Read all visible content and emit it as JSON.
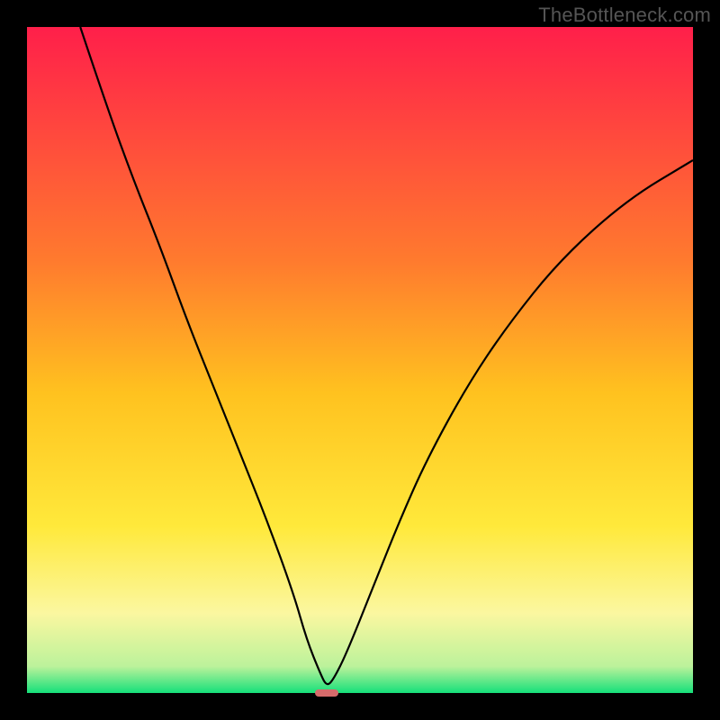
{
  "watermark": "TheBottleneck.com",
  "chart_data": {
    "type": "line",
    "title": "",
    "xlabel": "",
    "ylabel": "",
    "xlim": [
      0,
      100
    ],
    "ylim": [
      0,
      100
    ],
    "grid": false,
    "legend": false,
    "background_gradient": {
      "stops": [
        {
          "pct": 0,
          "color": "#ff1f4a"
        },
        {
          "pct": 35,
          "color": "#ff7a2e"
        },
        {
          "pct": 55,
          "color": "#ffc21f"
        },
        {
          "pct": 75,
          "color": "#ffe93b"
        },
        {
          "pct": 88,
          "color": "#fbf7a0"
        },
        {
          "pct": 96,
          "color": "#bcf29b"
        },
        {
          "pct": 100,
          "color": "#15e07a"
        }
      ]
    },
    "series": [
      {
        "name": "bottleneck-curve",
        "color": "#000000",
        "x": [
          8,
          12,
          16,
          20,
          24,
          28,
          32,
          36,
          40,
          42,
          44,
          45,
          46,
          48,
          52,
          56,
          60,
          66,
          72,
          80,
          90,
          100
        ],
        "y": [
          100,
          88,
          77,
          67,
          56,
          46,
          36,
          26,
          15,
          8,
          3,
          1,
          2,
          6,
          16,
          26,
          35,
          46,
          55,
          65,
          74,
          80
        ]
      }
    ],
    "marker": {
      "name": "optimal-point",
      "x": 45,
      "y": 0,
      "color": "#d66b6b",
      "width_pct": 3.4,
      "height_pct": 1.2
    }
  }
}
